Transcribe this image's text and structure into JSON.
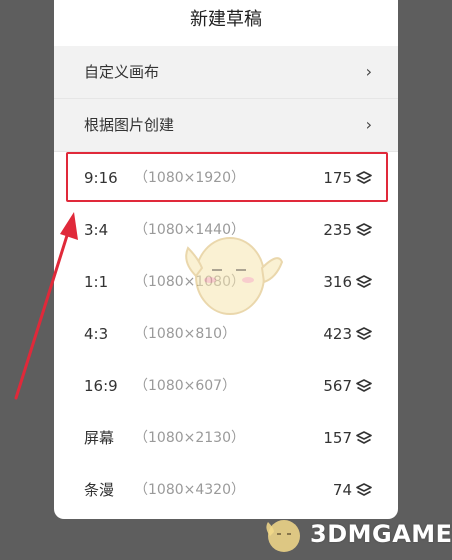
{
  "dialog": {
    "title": "新建草稿",
    "options": [
      {
        "label": "自定义画布",
        "chevron": "›"
      },
      {
        "label": "根据图片创建",
        "chevron": "›"
      }
    ],
    "sizes": [
      {
        "ratio": "9:16",
        "resolution": "（1080×1920）",
        "count": "175"
      },
      {
        "ratio": "3:4",
        "resolution": "（1080×1440）",
        "count": "235"
      },
      {
        "ratio": "1:1",
        "resolution": "（1080×1080）",
        "count": "316"
      },
      {
        "ratio": "4:3",
        "resolution": "（1080×810）",
        "count": "423"
      },
      {
        "ratio": "16:9",
        "resolution": "（1080×607）",
        "count": "567"
      },
      {
        "ratio": "屏幕",
        "resolution": "（1080×2130）",
        "count": "157"
      },
      {
        "ratio": "条漫",
        "resolution": "（1080×4320）",
        "count": "74"
      }
    ],
    "count_icon": "layers-icon"
  },
  "annotation": {
    "highlight_color": "#e0293a",
    "arrow_color": "#e0293a"
  },
  "watermark": {
    "text": "3DMGAME"
  }
}
